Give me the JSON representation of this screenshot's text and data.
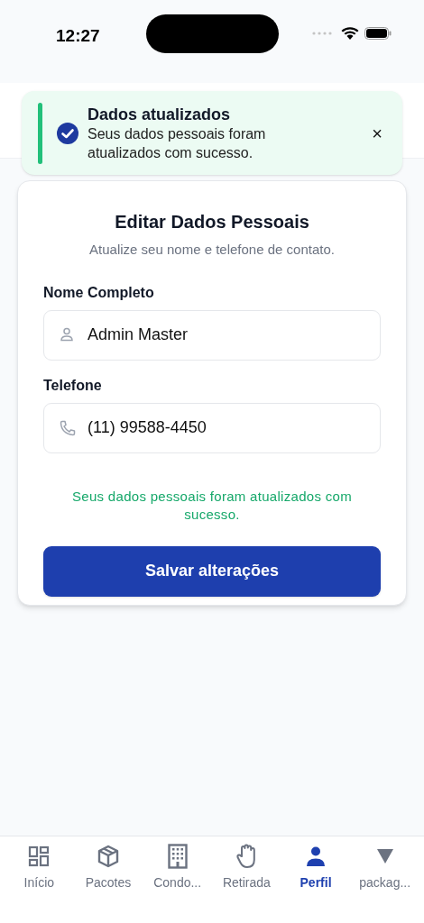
{
  "status_bar": {
    "time": "12:27"
  },
  "toast": {
    "title": "Dados atualizados",
    "message": "Seus dados pessoais foram atualizados com sucesso.",
    "close": "×"
  },
  "form": {
    "title": "Editar Dados Pessoais",
    "subtitle": "Atualize seu nome e telefone de contato.",
    "fields": [
      {
        "label": "Nome Completo",
        "value": "Admin Master",
        "kind": "person"
      },
      {
        "label": "Telefone",
        "value": "(11) 99588-4450",
        "kind": "phone"
      }
    ],
    "success_message": "Seus dados pessoais foram atualizados com sucesso.",
    "submit": "Salvar alterações"
  },
  "tab_bar": [
    {
      "label": "Início",
      "selected": false
    },
    {
      "label": "Pacotes",
      "selected": false
    },
    {
      "label": "Condo...",
      "selected": false
    },
    {
      "label": "Retirada",
      "selected": false
    },
    {
      "label": "Perfil",
      "selected": true
    },
    {
      "label": "packag...",
      "selected": false
    }
  ]
}
